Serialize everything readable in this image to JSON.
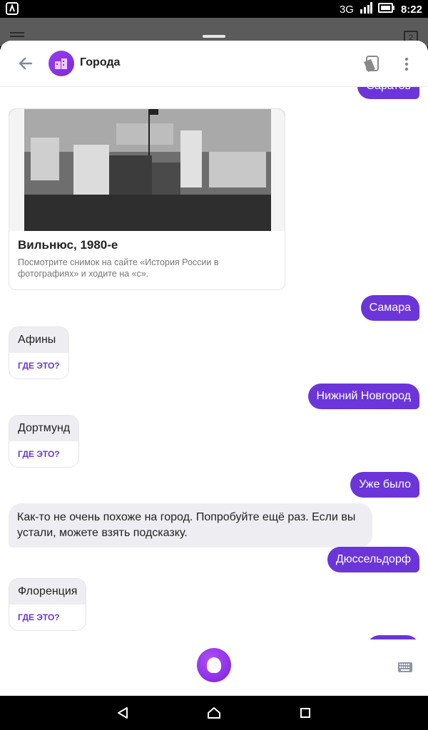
{
  "status_bar": {
    "network": "3G",
    "time": "8:22"
  },
  "browser_behind": {
    "tabs_count": "2"
  },
  "header": {
    "title": "Города"
  },
  "messages": {
    "user_saratov": "Саратов",
    "card": {
      "title": "Вильнюс, 1980-е",
      "description": "Посмотрите снимок на сайте «История России в фотографиях» и ходите на «с»."
    },
    "user_samara": "Самара",
    "bot_athens": {
      "name": "Афины",
      "action": "ГДЕ ЭТО?"
    },
    "user_nnovgorod": "Нижний Новгород",
    "bot_dortmund": {
      "name": "Дортмунд",
      "action": "ГДЕ ЭТО?"
    },
    "user_already": "Уже было",
    "bot_hint": "Как-то не очень похоже на город. Попробуйте ещё раз. Если вы устали, можете взять подсказку.",
    "user_dusseldorf": "Дюссельдорф",
    "bot_florence": {
      "name": "Флоренция",
      "action": "ГДЕ ЭТО?"
    }
  },
  "colors": {
    "accent": "#6b35d9",
    "bot_bubble": "#eeeef2"
  }
}
